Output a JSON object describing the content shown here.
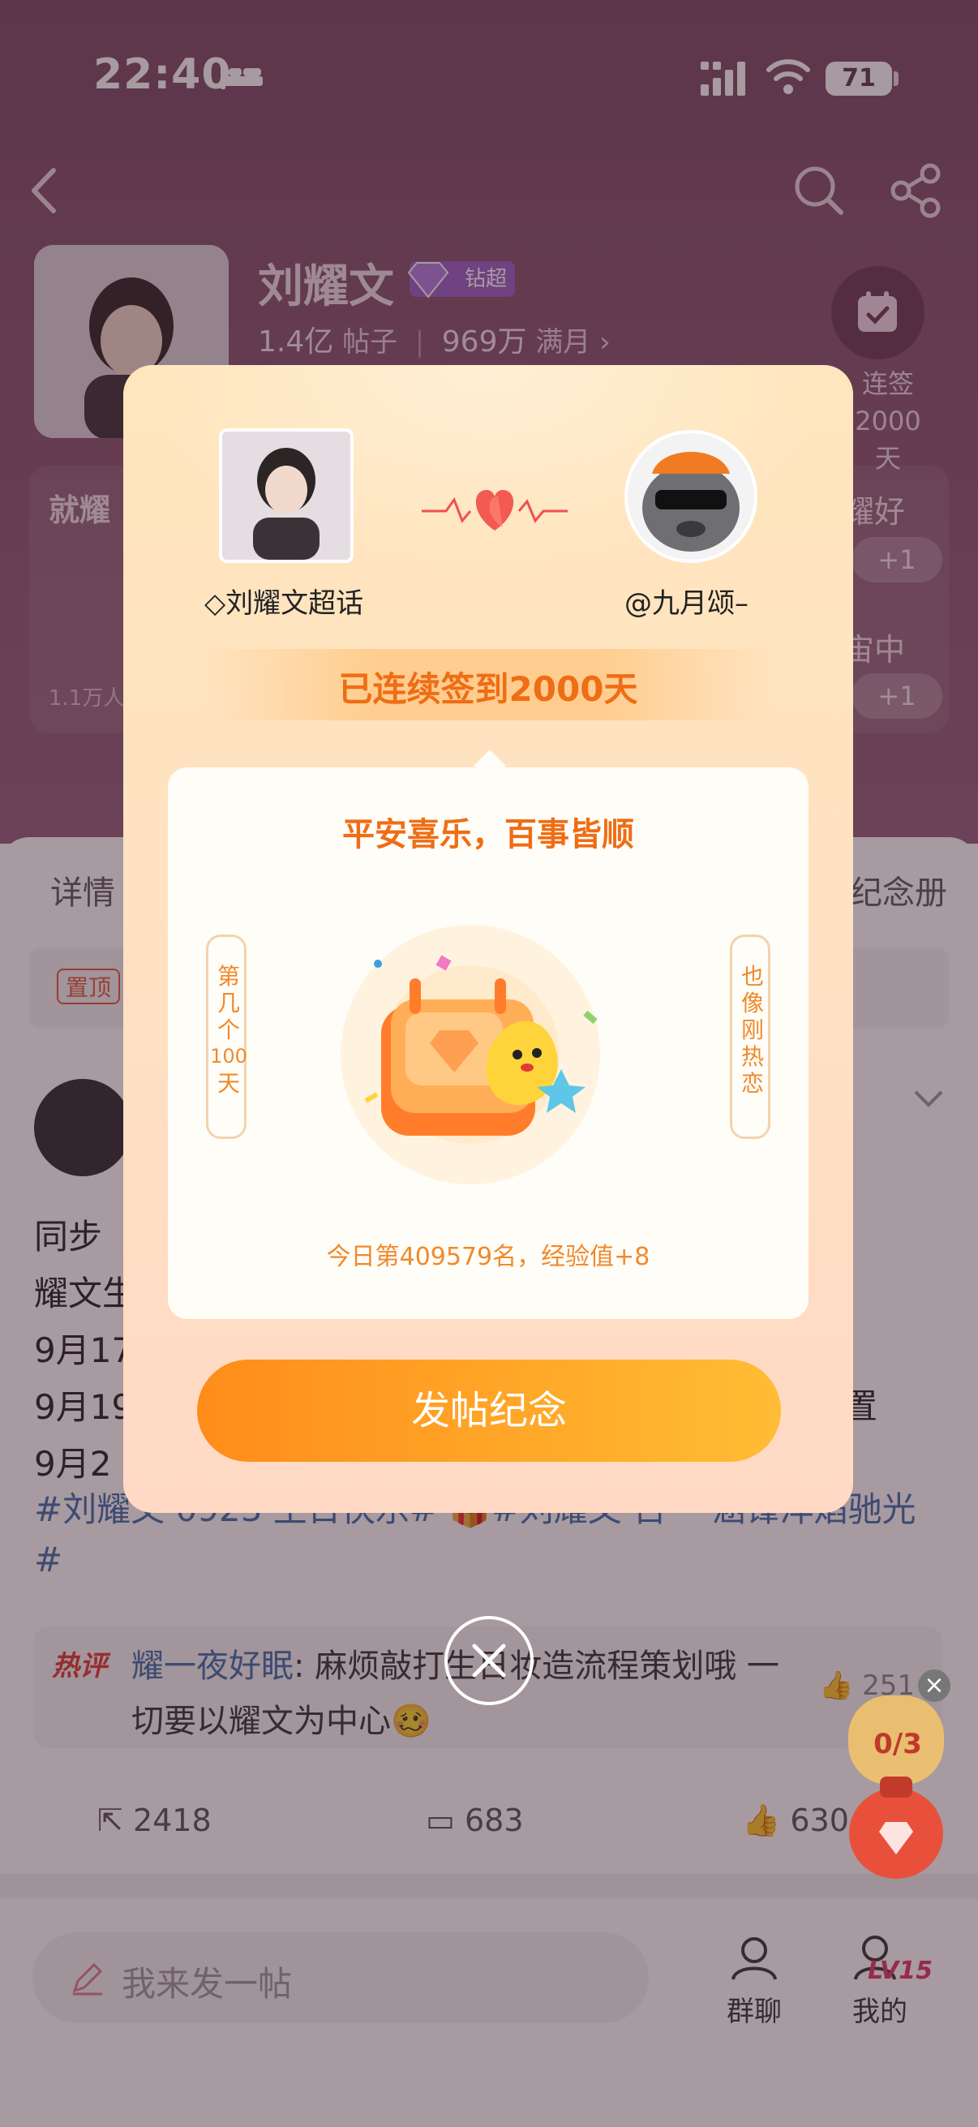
{
  "status_bar": {
    "time": "22:40",
    "battery": "71"
  },
  "topic": {
    "name": "刘耀文",
    "badge": "钻超",
    "posts_count": "1.4亿",
    "posts_label": "帖子",
    "members_count": "969万",
    "members_label": "满月",
    "checkin_label": "连签",
    "checkin_days": "2000天"
  },
  "cards": {
    "left_title": "就耀",
    "left_count": "1.1万人",
    "right_title_1": "耀好",
    "right_title_2": "宙中",
    "plus_label": "+1"
  },
  "tabs": {
    "detail": "详情",
    "album": "纪念册"
  },
  "pin_tag": "置顶",
  "post": {
    "lines": [
      "同步",
      "耀文生",
      "9月17",
      "9月19",
      "9月2"
    ],
    "hashtags": "#刘耀文 0923 生日快乐# 🎁#刘耀文 百一 涵锋淬焰驰光#",
    "right_fragment": "置"
  },
  "hot_comment": {
    "tag": "热评",
    "author": "耀一夜好眠",
    "text": "麻烦敲打生日妆造流程策划哦 一切要以耀文为中心🥴",
    "likes": "251"
  },
  "actions": {
    "repost": "2418",
    "comment": "683",
    "like": "630"
  },
  "bottom_bar": {
    "post_placeholder": "我来发一帖",
    "group_chat": "群聊",
    "mine": "我的",
    "level": "LV15"
  },
  "task_bag": {
    "progress": "0/3"
  },
  "dialog": {
    "topic_label": "刘耀文超话",
    "user_label": "@九月颂–",
    "streak": "已连续签到2000天",
    "blessing": "平安喜乐，百事皆顺",
    "side_left": [
      "第",
      "几",
      "个",
      "100",
      "天"
    ],
    "side_right": [
      "也",
      "像",
      "刚",
      "热",
      "恋"
    ],
    "rank": "今日第409579名，经验值+8",
    "cta": "发帖纪念"
  },
  "colors": {
    "accent": "#ef6d14",
    "cta_start": "#ff8c1a",
    "cta_end": "#ffbd34",
    "hashtag": "#3f6fa9",
    "hot": "#e23a30"
  }
}
